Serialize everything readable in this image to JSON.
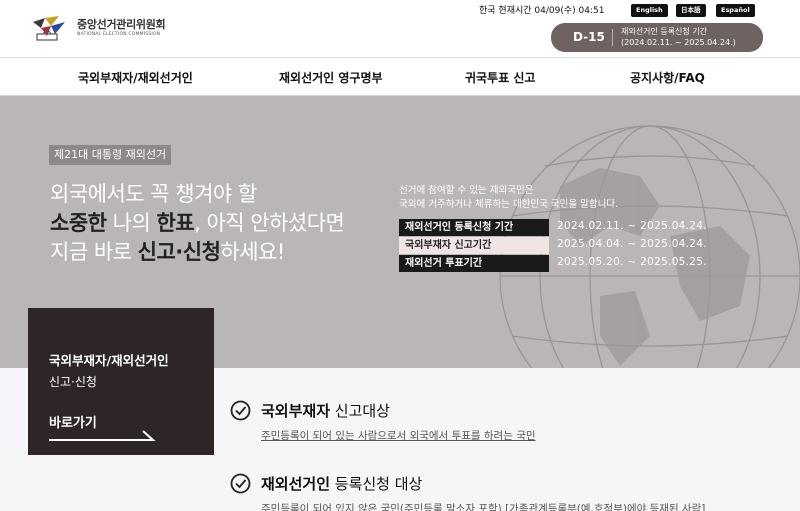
{
  "header": {
    "logo_ko": "중앙선거관리위원회",
    "logo_en": "NATIONAL ELECTION COMMISSION",
    "clock": "한국 현재시간 04/09(수) 04:51",
    "languages": [
      "English",
      "日本語",
      "Español"
    ],
    "dday": {
      "count": "D-15",
      "line1": "재외선거인 등록신청 기간",
      "line2": "(2024.02.11. ~ 2025.04.24.)"
    }
  },
  "nav": {
    "items": [
      "국외부재자/재외선거인",
      "재외선거인 영구명부",
      "귀국투표 신고",
      "공지사항/FAQ"
    ]
  },
  "hero": {
    "tag": "제21대 대통령 재외선거",
    "line1": "외국에서도 꼭 챙겨야 할",
    "line2_a": "소중한",
    "line2_b": " 나의 ",
    "line2_c": "한표",
    "line2_d": ", 아직 안하셨다면",
    "line3_a": "지금 바로 ",
    "line3_b": "신고·신청",
    "line3_c": "하세요!",
    "desc1": "선거에 참여할 수 있는 재외국민은",
    "desc2": "국외에 거주하거나 체류하는 대한민국 국민을 말합니다.",
    "periods": [
      {
        "label": "재외선거인 등록신청 기간",
        "date": "2024.02.11. ~ 2025.04.24."
      },
      {
        "label": "국외부재자 신고기간",
        "date": "2025.04.04. ~ 2025.04.24."
      },
      {
        "label": "재외선거 투표기간",
        "date": "2025.05.20. ~ 2025.05.25."
      }
    ]
  },
  "card": {
    "title1": "국외부재자/재외선거인",
    "title2": "신고·신청",
    "link": "바로가기"
  },
  "items": [
    {
      "title_bold": "국외부재자",
      "title_rest": " 신고대상",
      "desc": "주민등록이 되어 있는 사람으로서 외국에서 투표를 하려는 국민"
    },
    {
      "title_bold": "재외선거인",
      "title_rest": " 등록신청 대상",
      "desc": "주민등록이 되어 있지 않은 국민(주민등록 말소자 포함) [가족관계등록부(예,호적부)에야 등재된 사람]"
    }
  ],
  "colors": {
    "hero_bg": "#bab6b8",
    "card_bg": "#2e2526",
    "dday_bg": "#6e6262"
  }
}
